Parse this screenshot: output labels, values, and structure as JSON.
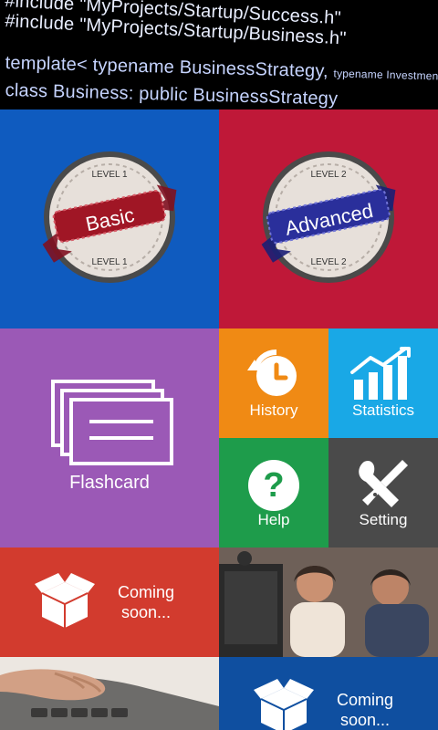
{
  "banner": {
    "line1": "#include \"MyProjects/Startup/Success.h\"",
    "line2": "#include \"MyProjects/Startup/Business.h\"",
    "line3a": "template< typename BusinessStrategy, ",
    "line3b": "typename Investment >",
    "line4": "class Business: public BusinessStrategy"
  },
  "tiles": {
    "basic": {
      "ribbon": "Basic",
      "level_top": "LEVEL 1",
      "level_bottom": "LEVEL 1"
    },
    "advanced": {
      "ribbon": "Advanced",
      "level_top": "LEVEL 2",
      "level_bottom": "LEVEL 2"
    },
    "flashcard": {
      "label": "Flashcard"
    },
    "history": {
      "label": "History"
    },
    "statistics": {
      "label": "Statistics"
    },
    "help": {
      "label": "Help"
    },
    "setting": {
      "label": "Setting"
    },
    "coming1": {
      "label_line1": "Coming",
      "label_line2": "soon..."
    },
    "coming2": {
      "label_line1": "Coming",
      "label_line2": "soon..."
    }
  },
  "colors": {
    "basic": "#0f5bbf",
    "advanced": "#bf1838",
    "flashcard": "#9b59b6",
    "history": "#f08a14",
    "statistics": "#19a8e6",
    "help": "#1e9c4b",
    "setting": "#4a4a4a",
    "coming1": "#d23b2e",
    "coming2": "#0f4fa0"
  },
  "icons": {
    "history": "history-clock-icon",
    "statistics": "bar-chart-icon",
    "help": "question-icon",
    "setting": "tools-icon",
    "flashcard": "flashcards-icon",
    "coming": "open-box-icon"
  }
}
